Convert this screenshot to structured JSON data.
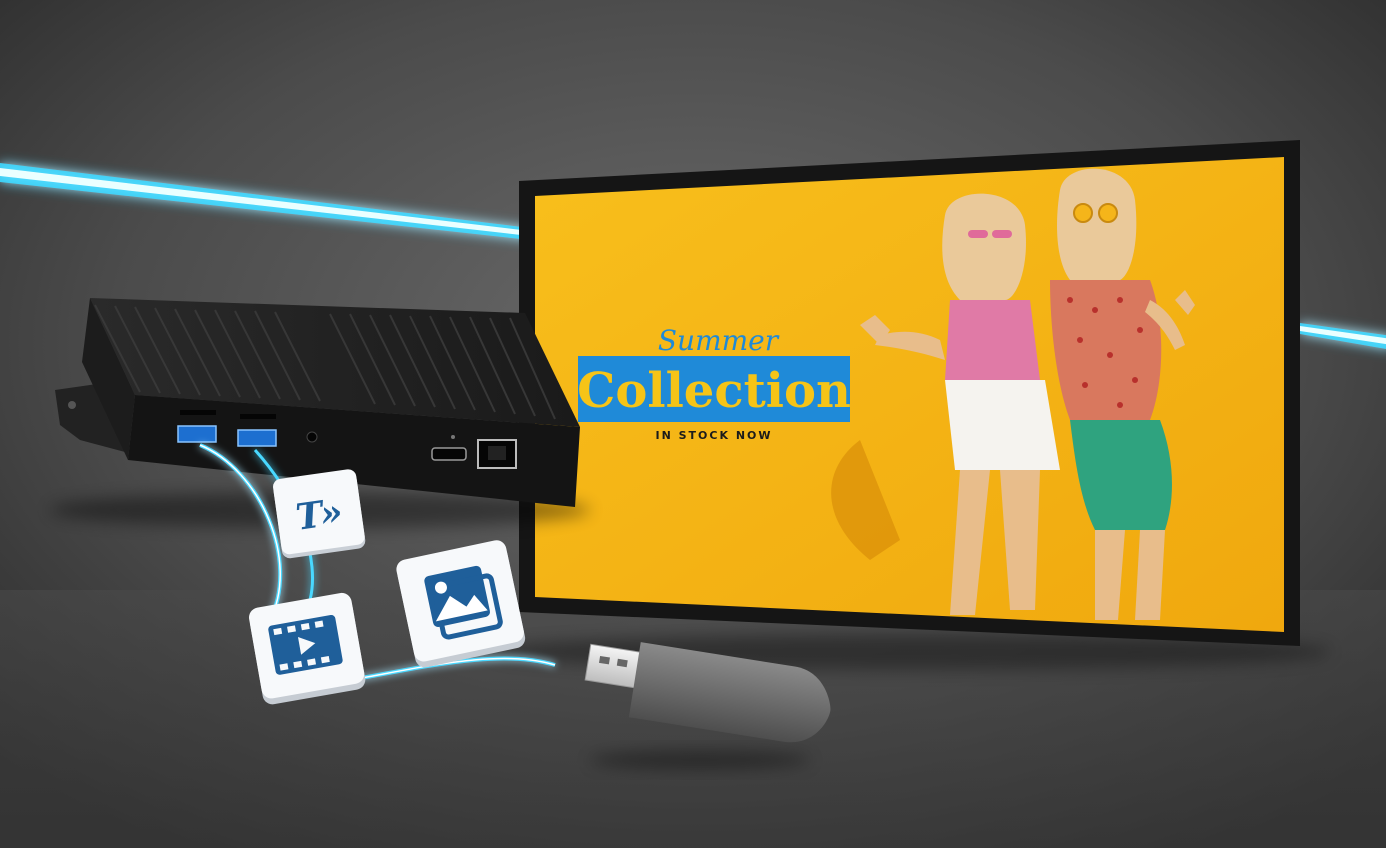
{
  "screen": {
    "headline_script": "Summer",
    "headline_main": "Collection",
    "tagline": "IN STOCK NOW"
  },
  "icons": {
    "text_tile_glyph": "T»",
    "text_tile": "text-icon",
    "image_tile": "image-icon",
    "video_tile": "video-icon"
  },
  "colors": {
    "background": "#555555",
    "neon": "#38d8ff",
    "screen_yellow": "#f7b716",
    "headline_box": "#1f8ad8",
    "headline_text": "#f6c417",
    "tile_blue": "#1f5f9a"
  }
}
